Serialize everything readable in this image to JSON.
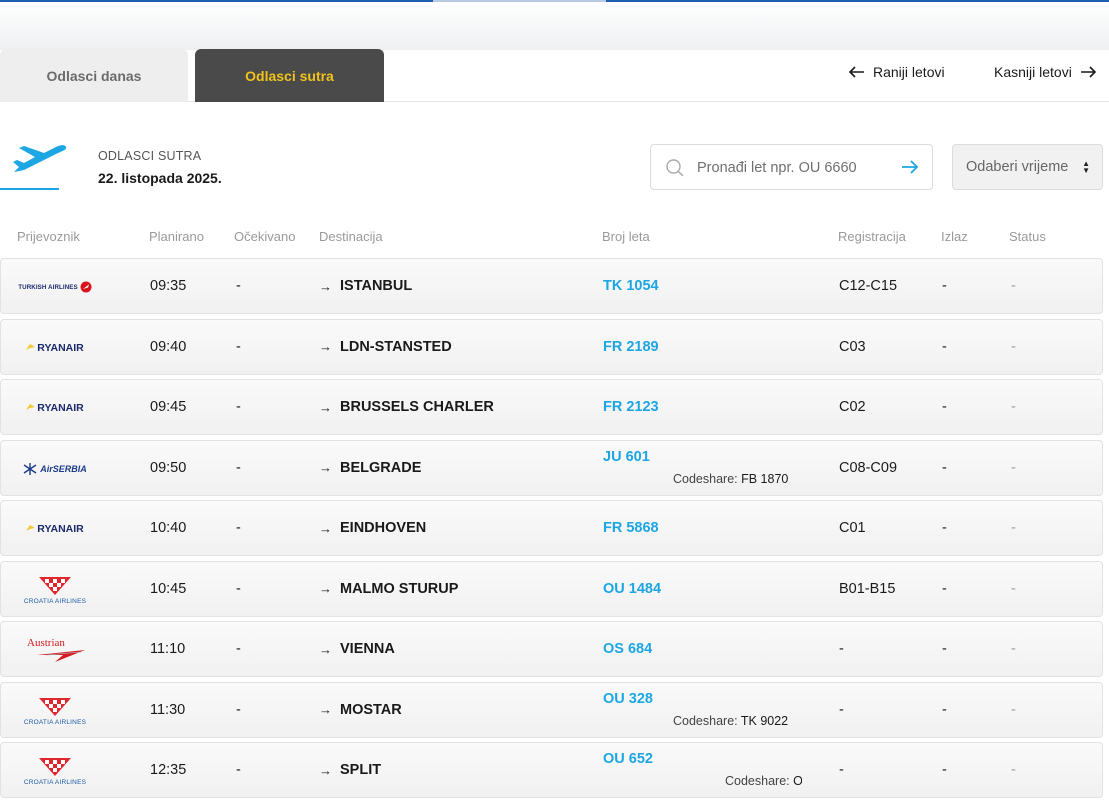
{
  "tabs": {
    "today": "Odlasci danas",
    "tomorrow": "Odlasci sutra"
  },
  "nav": {
    "earlier": "Raniji letovi",
    "later": "Kasniji letovi"
  },
  "header": {
    "label": "ODLASCI SUTRA",
    "date": "22. listopada 2025."
  },
  "search": {
    "placeholder": "Pronađi let npr. OU 6660"
  },
  "time_select": {
    "label": "Odaberi vrijeme"
  },
  "columns": {
    "carrier": "Prijevoznik",
    "scheduled": "Planirano",
    "expected": "Očekivano",
    "destination": "Destinacija",
    "flight": "Broj leta",
    "registration": "Registracija",
    "gate": "Izlaz",
    "status": "Status"
  },
  "codeshare_label": "Codeshare:",
  "flights": [
    {
      "airline": "TURKISH AIRLINES",
      "logo": "turkish",
      "scheduled": "09:35",
      "expected": "-",
      "destination": "ISTANBUL",
      "flight": "TK 1054",
      "codeshare": "",
      "registration": "C12-C15",
      "gate": "-",
      "status": "-"
    },
    {
      "airline": "RYANAIR",
      "logo": "ryanair",
      "scheduled": "09:40",
      "expected": "-",
      "destination": "LDN-STANSTED",
      "flight": "FR 2189",
      "codeshare": "",
      "registration": "C03",
      "gate": "-",
      "status": "-"
    },
    {
      "airline": "RYANAIR",
      "logo": "ryanair",
      "scheduled": "09:45",
      "expected": "-",
      "destination": "BRUSSELS CHARLER",
      "flight": "FR 2123",
      "codeshare": "",
      "registration": "C02",
      "gate": "-",
      "status": "-"
    },
    {
      "airline": "AirSERBIA",
      "logo": "airserbia",
      "scheduled": "09:50",
      "expected": "-",
      "destination": "BELGRADE",
      "flight": "JU 601",
      "codeshare": "FB 1870",
      "registration": "C08-C09",
      "gate": "-",
      "status": "-"
    },
    {
      "airline": "RYANAIR",
      "logo": "ryanair",
      "scheduled": "10:40",
      "expected": "-",
      "destination": "EINDHOVEN",
      "flight": "FR 5868",
      "codeshare": "",
      "registration": "C01",
      "gate": "-",
      "status": "-"
    },
    {
      "airline": "CROATIA AIRLINES",
      "logo": "croatia",
      "scheduled": "10:45",
      "expected": "-",
      "destination": "MALMO STURUP",
      "flight": "OU 1484",
      "codeshare": "",
      "registration": "B01-B15",
      "gate": "-",
      "status": "-"
    },
    {
      "airline": "Austrian",
      "logo": "austrian",
      "scheduled": "11:10",
      "expected": "-",
      "destination": "VIENNA",
      "flight": "OS 684",
      "codeshare": "",
      "registration": "-",
      "gate": "-",
      "status": "-"
    },
    {
      "airline": "CROATIA AIRLINES",
      "logo": "croatia",
      "scheduled": "11:30",
      "expected": "-",
      "destination": "MOSTAR",
      "flight": "OU 328",
      "codeshare": "TK 9022",
      "registration": "-",
      "gate": "-",
      "status": "-"
    },
    {
      "airline": "CROATIA AIRLINES",
      "logo": "croatia",
      "scheduled": "12:35",
      "expected": "-",
      "destination": "SPLIT",
      "flight": "OU 652",
      "codeshare": "OS",
      "registration": "-",
      "gate": "-",
      "status": "-"
    }
  ],
  "colors": {
    "accent": "#1ca6e3",
    "active_tab_bg": "#4a4a4a",
    "active_tab_text": "#f2c21b"
  }
}
